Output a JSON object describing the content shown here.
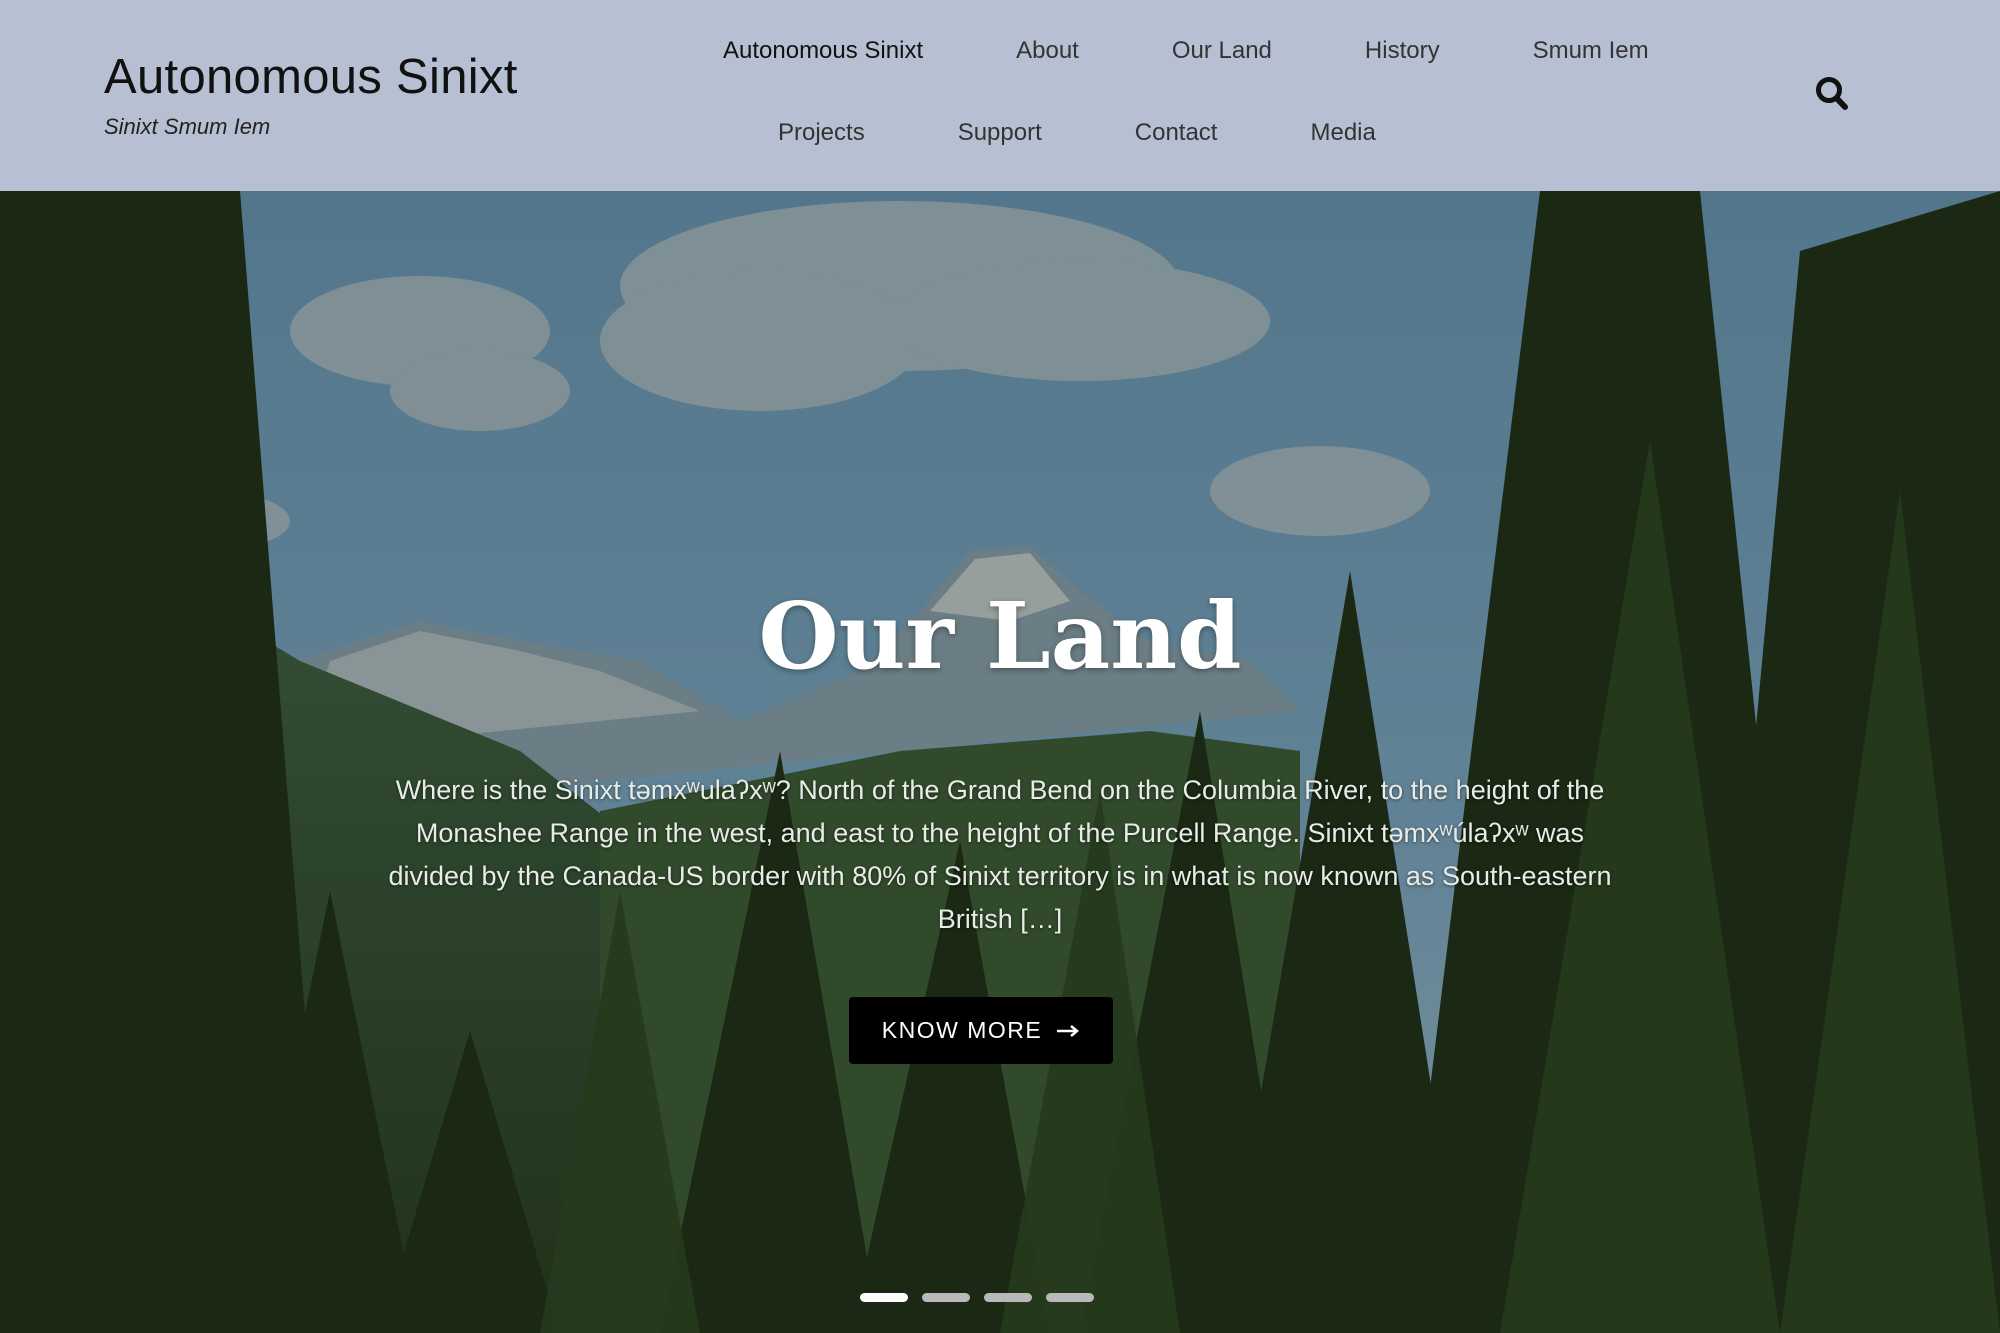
{
  "header": {
    "title": "Autonomous Sinixt",
    "tagline": "Sinixt Smum Iem"
  },
  "nav": {
    "row1": [
      "Autonomous Sinixt",
      "About",
      "Our Land",
      "History",
      "Smum Iem"
    ],
    "row2": [
      "Projects",
      "Support",
      "Contact",
      "Media"
    ],
    "active": "Autonomous Sinixt",
    "search_icon": "search-icon"
  },
  "hero": {
    "title": "Our Land",
    "text": "Where is the Sinixt təmxʷulaʔxʷ? North of the Grand Bend on the Columbia River, to the height of the Monashee Range in the west, and east to the height of the Purcell Range. Sinixt təmxʷúlaʔxʷ was divided by the Canada-US border with 80% of Sinixt territory is in what is now known as South-eastern British […]",
    "button_label": "KNOW MORE",
    "button_icon": "arrow-right-icon",
    "slides": 4,
    "active_slide": 1
  },
  "colors": {
    "header_bg": "#b7c0d2",
    "button_bg": "#000000",
    "title": "#ffffff"
  }
}
